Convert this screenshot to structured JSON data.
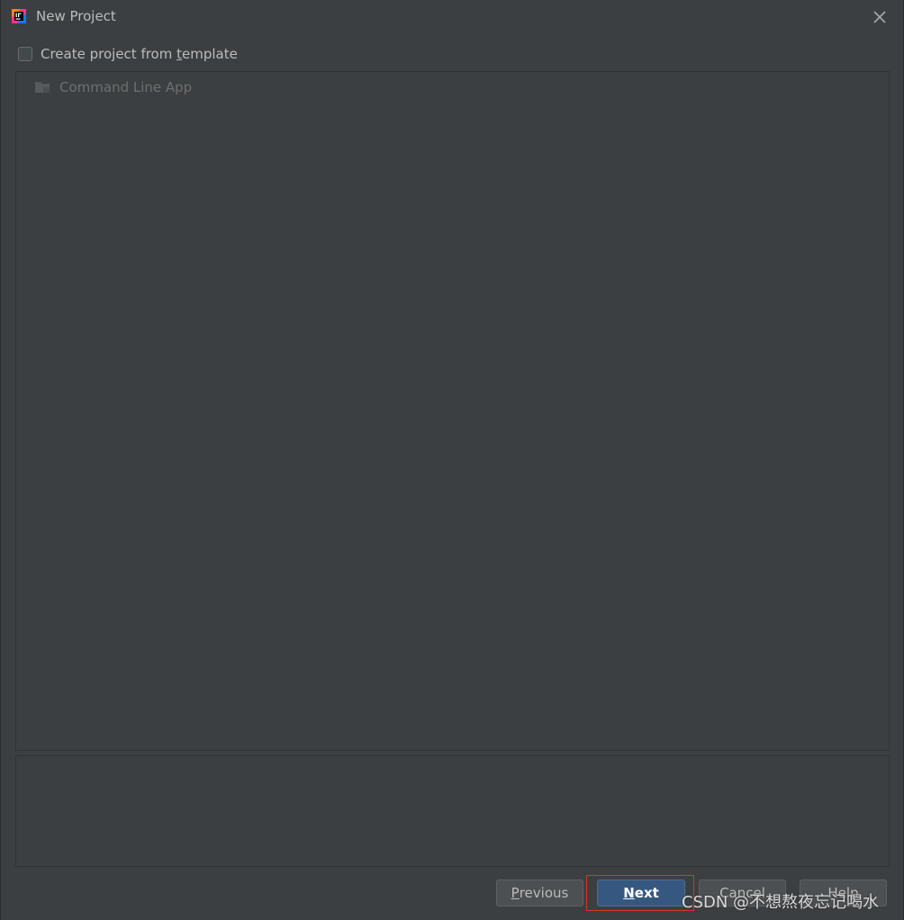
{
  "window": {
    "title": "New Project",
    "app_icon": "intellij-idea-icon",
    "close_icon": "close-icon"
  },
  "template_option": {
    "label_before": "Create project from ",
    "label_mnemonic": "t",
    "label_after": "emplate",
    "checked": false
  },
  "template_list": {
    "items": [
      {
        "label": "Command Line App",
        "icon": "folder-icon",
        "enabled": false
      }
    ]
  },
  "description": {
    "text": ""
  },
  "buttons": {
    "previous": {
      "mnemonic": "P",
      "rest": "revious"
    },
    "next": {
      "mnemonic": "N",
      "rest": "ext"
    },
    "cancel": {
      "label": "Cancel"
    },
    "help": {
      "label": "Help"
    }
  },
  "watermark": {
    "text": "CSDN @不想熬夜忘记喝水"
  },
  "colors": {
    "background": "#3c3f41",
    "primary_button": "#365880",
    "highlight_box": "#e0302a"
  }
}
